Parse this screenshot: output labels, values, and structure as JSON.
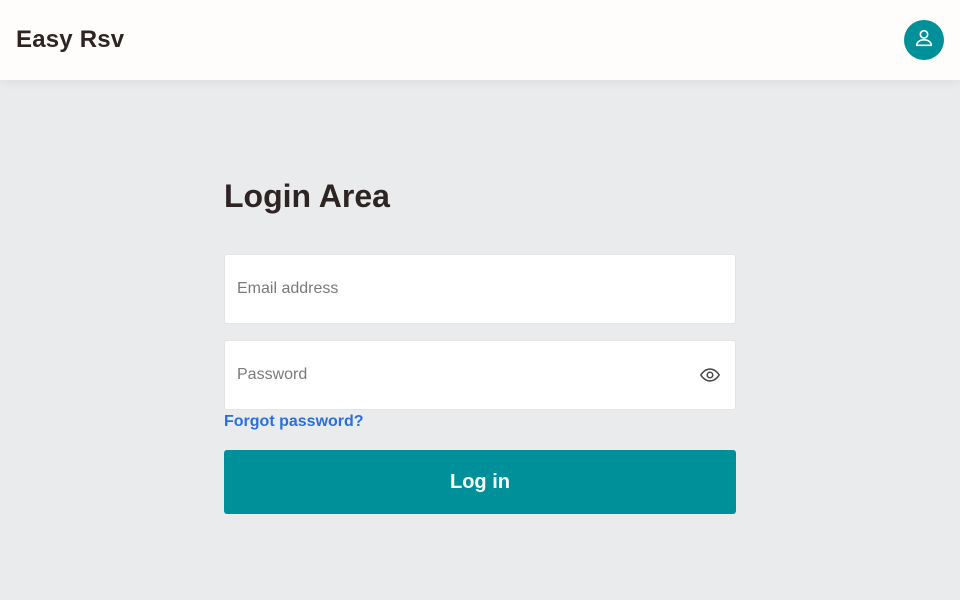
{
  "header": {
    "brand": "Easy Rsv",
    "avatar_icon": "user-icon",
    "accent_color": "#00909a"
  },
  "login": {
    "title": "Login Area",
    "email": {
      "placeholder": "Email address",
      "value": ""
    },
    "password": {
      "placeholder": "Password",
      "value": "",
      "toggle_icon": "eye-icon"
    },
    "forgot_label": "Forgot password?",
    "submit_label": "Log in"
  }
}
